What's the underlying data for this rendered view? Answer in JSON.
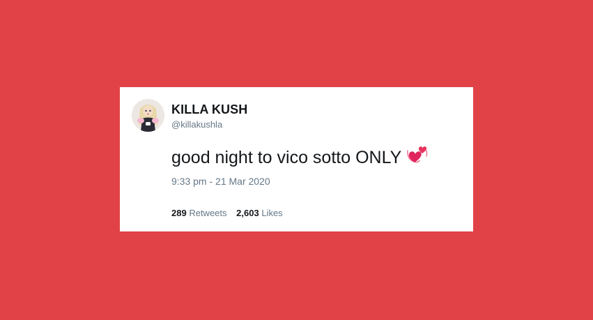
{
  "tweet": {
    "display_name": "KILLA KUSH",
    "handle": "@killakushla",
    "text": "good night to vico sotto ONLY",
    "emoji_icon": "two-hearts-icon",
    "timestamp": "9:33 pm - 21 Mar 2020",
    "retweets_count": "289",
    "retweets_label": "Retweets",
    "likes_count": "2,603",
    "likes_label": "Likes"
  },
  "colors": {
    "background": "#e04247",
    "card": "#ffffff",
    "text_primary": "#14171a",
    "text_secondary": "#657786",
    "heart": "#e0245e"
  }
}
